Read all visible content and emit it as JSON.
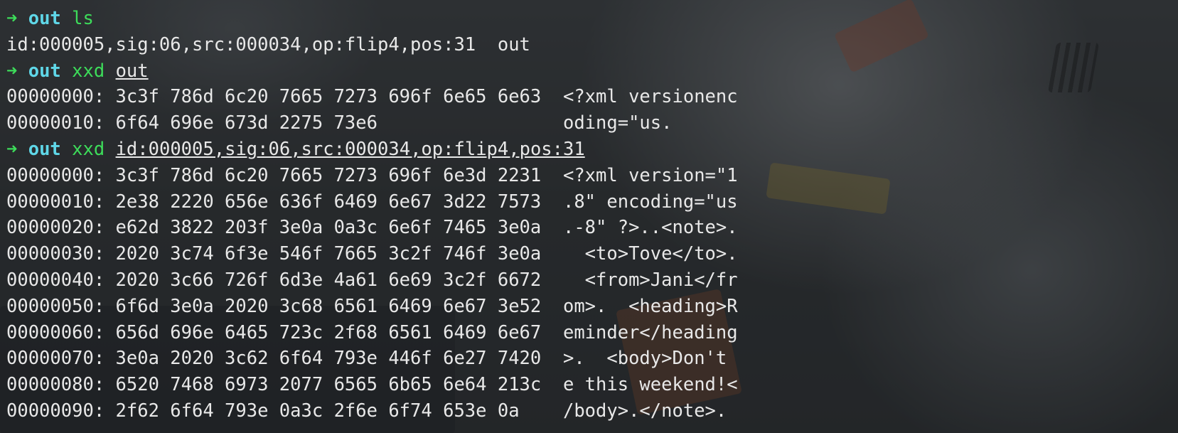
{
  "terminal": {
    "prompt_symbol": "➜",
    "prompt_dir": "out",
    "blocks": [
      {
        "command": "ls",
        "argument": "",
        "output": [
          "id:000005,sig:06,src:000034,op:flip4,pos:31  out"
        ]
      },
      {
        "command": "xxd",
        "argument": "out",
        "output": [
          "00000000: 3c3f 786d 6c20 7665 7273 696f 6e65 6e63  <?xml versionenc",
          "00000010: 6f64 696e 673d 2275 73e6                 oding=\"us."
        ]
      },
      {
        "command": "xxd",
        "argument": "id:000005,sig:06,src:000034,op:flip4,pos:31",
        "output": [
          "00000000: 3c3f 786d 6c20 7665 7273 696f 6e3d 2231  <?xml version=\"1",
          "00000010: 2e38 2220 656e 636f 6469 6e67 3d22 7573  .8\" encoding=\"us",
          "00000020: e62d 3822 203f 3e0a 0a3c 6e6f 7465 3e0a  .-8\" ?>..<note>.",
          "00000030: 2020 3c74 6f3e 546f 7665 3c2f 746f 3e0a    <to>Tove</to>.",
          "00000040: 2020 3c66 726f 6d3e 4a61 6e69 3c2f 6672    <from>Jani</fr",
          "00000050: 6f6d 3e0a 2020 3c68 6561 6469 6e67 3e52  om>.  <heading>R",
          "00000060: 656d 696e 6465 723c 2f68 6561 6469 6e67  eminder</heading",
          "00000070: 3e0a 2020 3c62 6f64 793e 446f 6e27 7420  >.  <body>Don't ",
          "00000080: 6520 7468 6973 2077 6565 6b65 6e64 213c  e this weekend!<",
          "00000090: 2f62 6f64 793e 0a3c 2f6e 6f74 653e 0a    /body>.</note>."
        ]
      }
    ]
  }
}
